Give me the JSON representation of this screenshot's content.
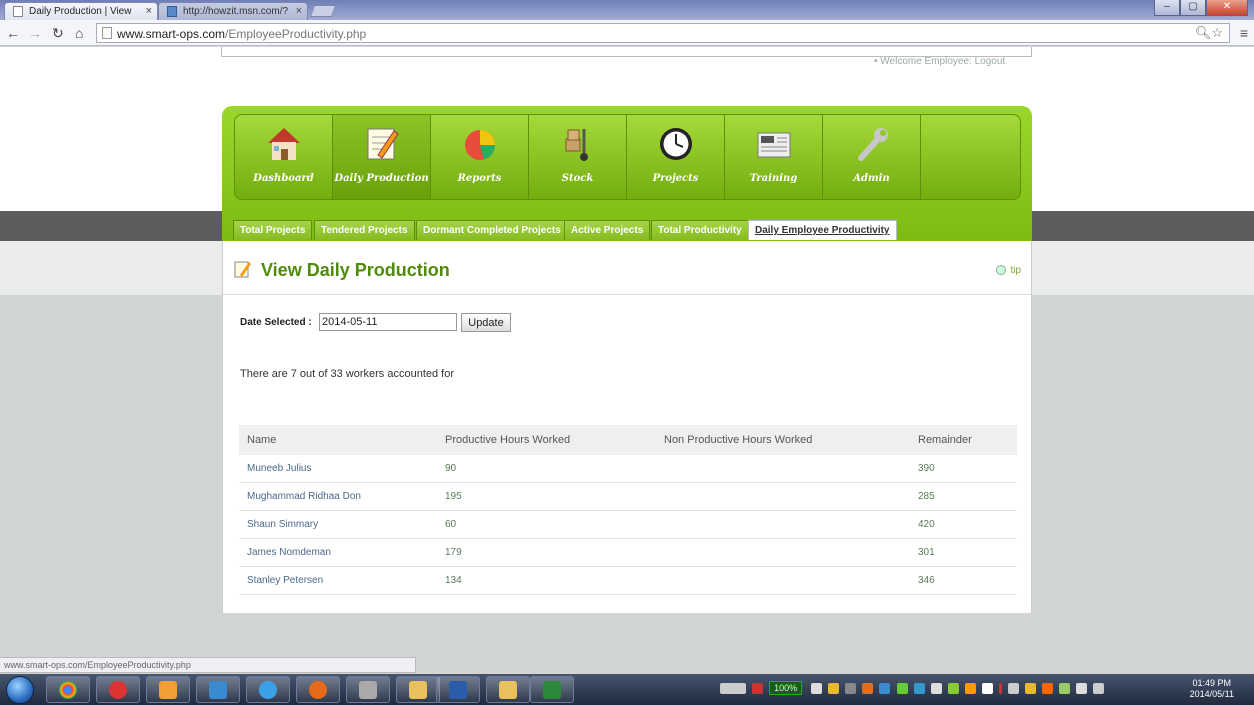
{
  "browser": {
    "tabs": [
      {
        "title": "Daily Production | View",
        "active": true
      },
      {
        "title": "http://howzit.msn.com/?",
        "active": false
      }
    ],
    "url_host": "www.smart-ops.com",
    "url_path": "/EmployeeProductivity.php",
    "status_url": "www.smart-ops.com/EmployeeProductivity.php"
  },
  "header": {
    "welcome": "Welcome Employee: Logout"
  },
  "nav": {
    "items": [
      {
        "label": "Dashboard",
        "icon": "house-icon"
      },
      {
        "label": "Daily Production",
        "icon": "notepad-pencil-icon"
      },
      {
        "label": "Reports",
        "icon": "pie-chart-icon"
      },
      {
        "label": "Stock",
        "icon": "hand-truck-icon"
      },
      {
        "label": "Projects",
        "icon": "clock-icon"
      },
      {
        "label": "Training",
        "icon": "newspaper-icon"
      },
      {
        "label": "Admin",
        "icon": "wrench-icon"
      }
    ]
  },
  "subtabs": [
    "Total Projects",
    "Tendered Projects",
    "Dormant Completed Projects",
    "Active Projects",
    "Total Productivity",
    "Daily Employee Productivity"
  ],
  "page": {
    "title": "View Daily Production",
    "tip": "tip",
    "date_label": "Date Selected :",
    "date_value": "2014-05-11",
    "update_label": "Update",
    "status": "There are 7 out of 33 workers accounted for"
  },
  "table": {
    "headers": [
      "Name",
      "Productive Hours Worked",
      "Non Productive Hours Worked",
      "Remainder"
    ],
    "rows": [
      {
        "name": "Muneeb Julius",
        "productive": "90",
        "non_productive": "",
        "remainder": "390"
      },
      {
        "name": "Mughammad Ridhaa Don",
        "productive": "195",
        "non_productive": "",
        "remainder": "285"
      },
      {
        "name": "Shaun Simmary",
        "productive": "60",
        "non_productive": "",
        "remainder": "420"
      },
      {
        "name": "James Nomdeman",
        "productive": "179",
        "non_productive": "",
        "remainder": "301"
      },
      {
        "name": "Stanley Petersen",
        "productive": "134",
        "non_productive": "",
        "remainder": "346"
      }
    ]
  },
  "taskbar": {
    "battery": "100%",
    "time": "01:49 PM",
    "date": "2014/05/11"
  },
  "colors": {
    "brand_green": "#7dbb12",
    "title_green": "#4f8a0a"
  }
}
